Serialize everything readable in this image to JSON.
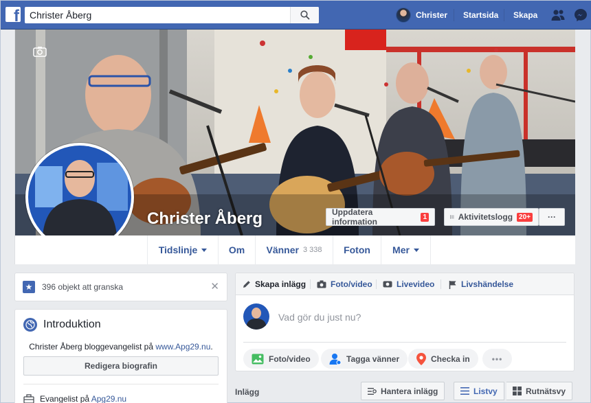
{
  "topbar": {
    "search_value": "Christer Åberg",
    "search_placeholder": "Sök",
    "profile_name": "Christer",
    "home_label": "Startsida",
    "create_label": "Skapa"
  },
  "cover": {
    "name": "Christer Åberg",
    "update_info_label": "Uppdatera information",
    "update_info_badge": "1",
    "activity_log_label": "Aktivitetslogg",
    "activity_log_badge": "20+",
    "more_label": "···"
  },
  "nav": {
    "timeline": "Tidslinje",
    "about": "Om",
    "friends": "Vänner",
    "friends_count": "3 338",
    "photos": "Foton",
    "more": "Mer"
  },
  "review": {
    "text": "396 objekt att granska",
    "close": "✕"
  },
  "intro": {
    "title": "Introduktion",
    "bio_text": "Christer Åberg bloggevangelist på ",
    "bio_link": "www.Apg29.nu",
    "bio_end": ".",
    "edit_bio_label": "Redigera biografin",
    "work_text": "Evangelist på ",
    "work_link": "Apg29.nu"
  },
  "composer": {
    "tabs": [
      "Skapa inlägg",
      "Foto/video",
      "Livevideo",
      "Livshändelse"
    ],
    "placeholder": "Vad gör du just nu?",
    "actions": [
      "Foto/video",
      "Tagga vänner",
      "Checka in"
    ],
    "more_label": "•••"
  },
  "posts": {
    "label": "Inlägg",
    "manage_label": "Hantera inlägg",
    "list_view_label": "Listvy",
    "grid_view_label": "Rutnätsvy"
  },
  "colors": {
    "brand": "#4267b2",
    "link": "#365899",
    "badge": "#fa3e3e"
  }
}
